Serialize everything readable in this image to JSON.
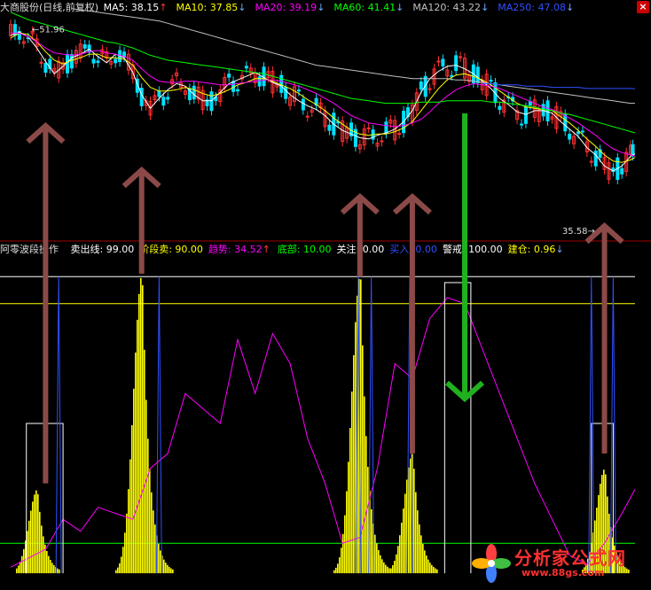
{
  "title": "大商股份(日线,前复权)",
  "ma": [
    {
      "label": "MA5:",
      "value": "38.15",
      "arrow": "↑",
      "color": "#ffffff",
      "dir": "up"
    },
    {
      "label": "MA10:",
      "value": "37.85",
      "arrow": "↓",
      "color": "#ffff00",
      "dir": "down"
    },
    {
      "label": "MA20:",
      "value": "39.19",
      "arrow": "↓",
      "color": "#ff00ff",
      "dir": "down"
    },
    {
      "label": "MA60:",
      "value": "41.41",
      "arrow": "↓",
      "color": "#00ff00",
      "dir": "down"
    },
    {
      "label": "MA120:",
      "value": "43.22",
      "arrow": "↓",
      "color": "#c0c0c0",
      "dir": "down"
    },
    {
      "label": "MA250:",
      "value": "47.08",
      "arrow": "↓",
      "color": "#3050ff",
      "dir": "down"
    }
  ],
  "price_labels": {
    "high": "51.96",
    "low": "35.58"
  },
  "indicator": {
    "name": "阿零波段操作",
    "items": [
      {
        "label": "卖出线:",
        "value": "99.00",
        "color": "#ffffff",
        "arrow": ""
      },
      {
        "label": "阶段卖:",
        "value": "90.00",
        "color": "#ffff00",
        "arrow": ""
      },
      {
        "label": "趋势:",
        "value": "34.52",
        "color": "#ff00ff",
        "arrow": "↑"
      },
      {
        "label": "底部:",
        "value": "10.00",
        "color": "#00ff00",
        "arrow": ""
      },
      {
        "label": "关注:",
        "value": "0.00",
        "color": "#ffffff",
        "arrow": ""
      },
      {
        "label": "买入:",
        "value": "0.00",
        "color": "#3050ff",
        "arrow": ""
      },
      {
        "label": "警戒:",
        "value": "100.00",
        "color": "#ffffff",
        "arrow": ""
      },
      {
        "label": "建仓:",
        "value": "0.96",
        "color": "#ffff00",
        "arrow": "↓"
      }
    ]
  },
  "watermark": {
    "name": "分析家公式网",
    "url": "www.88gs.com"
  },
  "chart_data": [
    {
      "type": "line",
      "title": "大商股份(日线,前复权)",
      "ylim": [
        35,
        53
      ],
      "x": [
        0,
        10,
        20,
        30,
        40,
        50,
        60,
        70,
        80,
        90,
        100,
        110,
        120,
        130,
        140,
        150,
        160,
        170,
        180,
        190,
        200,
        210,
        220,
        230,
        240,
        250,
        260,
        270,
        280,
        290,
        300,
        310,
        320,
        330,
        340,
        350,
        360,
        370,
        380,
        390,
        400,
        410,
        420,
        430,
        440,
        450,
        460,
        470,
        480,
        490,
        500,
        510,
        520,
        530,
        540,
        550,
        560,
        570,
        580,
        590,
        600,
        610,
        620,
        630,
        640,
        650,
        660,
        670,
        680,
        690,
        700,
        710,
        715
      ],
      "series": [
        {
          "name": "MA5",
          "color": "#ffffff",
          "values": [
            51.4,
            51.7,
            51.3,
            50.4,
            49.3,
            48.3,
            48.9,
            49.6,
            49.9,
            50.3,
            49.7,
            49.2,
            49.9,
            49.6,
            48.4,
            46.6,
            45.5,
            46.3,
            47.0,
            47.5,
            47.3,
            46.6,
            46.1,
            46.1,
            46.8,
            47.5,
            47.8,
            48.1,
            48.4,
            48.0,
            47.6,
            47.3,
            46.6,
            46.1,
            45.7,
            45.4,
            44.9,
            44.2,
            43.7,
            43.4,
            43.1,
            43.0,
            43.3,
            43.5,
            43.8,
            44.4,
            45.3,
            46.8,
            47.9,
            48.5,
            48.9,
            49.0,
            48.7,
            48.3,
            47.7,
            47.1,
            46.3,
            45.8,
            45.2,
            45.0,
            45.3,
            45.3,
            45.1,
            44.4,
            43.8,
            43.2,
            42.3,
            41.7,
            40.8,
            40.4,
            40.8,
            41.6,
            41.8
          ]
        },
        {
          "name": "MA10",
          "color": "#ffff00",
          "values": [
            51.2,
            51.6,
            51.5,
            50.9,
            50.1,
            49.4,
            49.1,
            49.4,
            49.6,
            49.9,
            49.9,
            49.6,
            49.6,
            49.5,
            49.0,
            48.0,
            47.2,
            46.9,
            46.9,
            47.0,
            47.2,
            47.0,
            46.7,
            46.5,
            46.7,
            47.0,
            47.4,
            47.6,
            47.9,
            47.9,
            47.7,
            47.4,
            47.1,
            46.7,
            46.2,
            45.8,
            45.3,
            44.7,
            44.2,
            43.7,
            43.4,
            43.3,
            43.4,
            43.4,
            43.6,
            43.9,
            44.4,
            45.3,
            46.2,
            47.1,
            47.8,
            48.2,
            48.3,
            48.1,
            47.8,
            47.4,
            46.9,
            46.4,
            45.9,
            45.6,
            45.5,
            45.4,
            45.3,
            44.8,
            44.3,
            43.7,
            43.0,
            42.4,
            41.7,
            41.2,
            41.1,
            41.3,
            41.5
          ]
        },
        {
          "name": "MA20",
          "color": "#ff00ff",
          "values": [
            51.6,
            51.6,
            51.3,
            50.9,
            50.4,
            50.0,
            49.9,
            49.8,
            49.9,
            50.1,
            50.2,
            50.0,
            49.9,
            49.7,
            49.4,
            48.7,
            48.1,
            47.7,
            47.6,
            47.6,
            47.7,
            47.7,
            47.6,
            47.5,
            47.4,
            47.4,
            47.5,
            47.6,
            47.7,
            47.8,
            47.8,
            47.7,
            47.5,
            47.3,
            47.0,
            46.7,
            46.3,
            45.9,
            45.4,
            44.9,
            44.6,
            44.3,
            44.2,
            44.1,
            44.0,
            44.1,
            44.3,
            44.6,
            45.2,
            45.9,
            46.5,
            47.0,
            47.3,
            47.5,
            47.4,
            47.3,
            47.1,
            46.8,
            46.5,
            46.2,
            45.9,
            45.6,
            45.4,
            45.1,
            44.7,
            44.3,
            43.8,
            43.3,
            42.7,
            42.2,
            41.9,
            41.7,
            41.6
          ]
        },
        {
          "name": "MA60",
          "color": "#00ff00",
          "values": [
            53.3,
            53.0,
            52.7,
            52.5,
            52.3,
            52.1,
            51.9,
            51.7,
            51.5,
            51.3,
            51.1,
            50.9,
            50.8,
            50.6,
            50.4,
            50.1,
            49.8,
            49.6,
            49.4,
            49.3,
            49.2,
            49.1,
            49.0,
            48.9,
            48.8,
            48.7,
            48.6,
            48.5,
            48.4,
            48.3,
            48.1,
            47.9,
            47.7,
            47.5,
            47.3,
            47.1,
            46.9,
            46.7,
            46.5,
            46.3,
            46.2,
            46.1,
            46.0,
            45.9,
            45.9,
            45.9,
            45.9,
            46.0,
            46.0,
            46.0,
            46.1,
            46.1,
            46.1,
            46.1,
            46.1,
            46.0,
            46.0,
            45.9,
            45.8,
            45.7,
            45.6,
            45.4,
            45.3,
            45.1,
            45.0,
            44.8,
            44.6,
            44.4,
            44.2,
            44.0,
            43.8,
            43.6,
            43.5
          ]
        },
        {
          "name": "MA120",
          "color": "#c0c0c0",
          "values": [
            null,
            null,
            null,
            null,
            null,
            null,
            null,
            53.6,
            53.5,
            53.4,
            53.3,
            53.2,
            53.1,
            53.0,
            52.9,
            52.8,
            52.7,
            52.6,
            52.4,
            52.2,
            52.0,
            51.8,
            51.6,
            51.4,
            51.2,
            51.0,
            50.8,
            50.6,
            50.4,
            50.2,
            50.0,
            49.8,
            49.6,
            49.4,
            49.2,
            49.0,
            48.9,
            48.8,
            48.7,
            48.6,
            48.5,
            48.4,
            48.3,
            48.2,
            48.1,
            48.0,
            47.9,
            47.9,
            47.9,
            47.9,
            47.9,
            47.8,
            47.8,
            47.7,
            47.6,
            47.5,
            47.4,
            47.3,
            47.2,
            47.1,
            47.0,
            46.9,
            46.8,
            46.7,
            46.6,
            46.5,
            46.4,
            46.3,
            46.2,
            46.1,
            46.0,
            45.9,
            45.9
          ]
        },
        {
          "name": "MA250",
          "color": "#3050ff",
          "values": [
            null,
            null,
            null,
            null,
            null,
            null,
            null,
            null,
            null,
            null,
            null,
            null,
            null,
            null,
            null,
            null,
            null,
            null,
            null,
            null,
            null,
            null,
            null,
            null,
            null,
            null,
            null,
            null,
            null,
            null,
            null,
            null,
            null,
            null,
            null,
            null,
            null,
            null,
            null,
            null,
            null,
            null,
            null,
            null,
            null,
            null,
            null,
            null,
            null,
            null,
            null,
            null,
            null,
            null,
            47.5,
            47.5,
            47.4,
            47.4,
            47.4,
            47.3,
            47.3,
            47.3,
            47.2,
            47.2,
            47.2,
            47.2,
            47.1,
            47.1,
            47.1,
            47.1,
            47.1,
            47.1,
            47.08
          ]
        }
      ]
    },
    {
      "type": "area",
      "title": "阿零波段操作",
      "ylim": [
        -5,
        105
      ],
      "levels": [
        {
          "name": "卖出线",
          "value": 99,
          "color": "#ffffff"
        },
        {
          "name": "阶段卖",
          "value": 90,
          "color": "#ffff00"
        },
        {
          "name": "底部",
          "value": 10,
          "color": "#00ff00"
        }
      ],
      "series": [
        {
          "name": "建仓",
          "color": "#ffff00",
          "peaks": [
            [
              30,
              28
            ],
            [
              150,
              100
            ],
            [
              400,
              100
            ],
            [
              460,
              40
            ],
            [
              680,
              35
            ]
          ]
        },
        {
          "name": "趋势",
          "color": "#ff00ff",
          "values_x": [
            0,
            20,
            40,
            60,
            80,
            100,
            120,
            140,
            160,
            180,
            200,
            220,
            240,
            260,
            280,
            300,
            320,
            340,
            360,
            380,
            400,
            420,
            440,
            460,
            480,
            500,
            520,
            540,
            560,
            580,
            600,
            620,
            640,
            660,
            680,
            700,
            715
          ],
          "values": [
            2,
            5,
            8,
            18,
            14,
            22,
            20,
            18,
            35,
            40,
            60,
            55,
            50,
            78,
            60,
            80,
            70,
            45,
            30,
            10,
            12,
            35,
            70,
            65,
            85,
            92,
            90,
            75,
            60,
            45,
            30,
            18,
            6,
            3,
            10,
            20,
            28
          ]
        },
        {
          "name": "关注",
          "color": "#ffffff",
          "segments": [
            [
              18,
              60,
              50
            ],
            [
              497,
              527,
              97
            ],
            [
              665,
              690,
              50
            ]
          ]
        },
        {
          "name": "买入",
          "color": "#3050ff",
          "spikes": [
            55,
            170,
            398,
            413,
            457,
            665,
            690
          ]
        }
      ]
    }
  ]
}
